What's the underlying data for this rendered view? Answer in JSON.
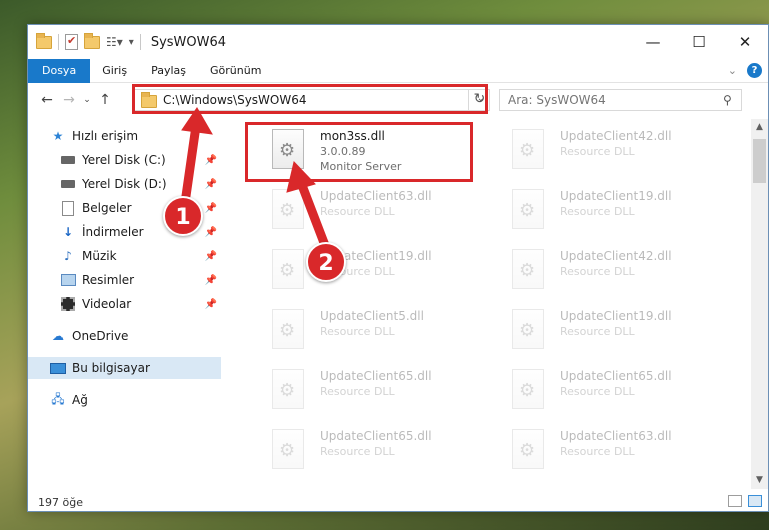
{
  "window": {
    "title": "SysWOW64",
    "controls": {
      "minimize": "—",
      "maximize": "☐",
      "close": "✕"
    }
  },
  "ribbon": {
    "tabs": [
      "Dosya",
      "Giriş",
      "Paylaş",
      "Görünüm"
    ],
    "active_tab": "Dosya"
  },
  "nav": {
    "address": "C:\\Windows\\SysWOW64",
    "search_placeholder": "Ara: SysWOW64"
  },
  "sidebar": {
    "items": [
      {
        "label": "Hızlı erişim",
        "icon": "star-icon",
        "pinned": false
      },
      {
        "label": "Yerel Disk (C:)",
        "icon": "drive-icon",
        "pinned": true
      },
      {
        "label": "Yerel Disk (D:)",
        "icon": "drive-icon",
        "pinned": true
      },
      {
        "label": "Belgeler",
        "icon": "documents-icon",
        "pinned": true
      },
      {
        "label": "İndirmeler",
        "icon": "downloads-icon",
        "pinned": true
      },
      {
        "label": "Müzik",
        "icon": "music-icon",
        "pinned": true
      },
      {
        "label": "Resimler",
        "icon": "pictures-icon",
        "pinned": true
      },
      {
        "label": "Videolar",
        "icon": "videos-icon",
        "pinned": true
      },
      {
        "label": "OneDrive",
        "icon": "onedrive-icon",
        "pinned": false
      },
      {
        "label": "Bu bilgisayar",
        "icon": "this-pc-icon",
        "pinned": false,
        "selected": true
      },
      {
        "label": "Ağ",
        "icon": "network-icon",
        "pinned": false
      }
    ]
  },
  "files": [
    {
      "name": "mon3ss.dll",
      "version": "3.0.0.89",
      "description": "Monitor Server",
      "highlighted": true
    },
    {
      "name": "UpdateClient42.dll",
      "description": "Resource DLL"
    },
    {
      "name": "UpdateClient63.dll",
      "description": "Resource DLL"
    },
    {
      "name": "UpdateClient19.dll",
      "description": "Resource DLL"
    },
    {
      "name": "UpdateClient19.dll",
      "description": "Resource DLL"
    },
    {
      "name": "UpdateClient42.dll",
      "description": "Resource DLL"
    },
    {
      "name": "UpdateClient5.dll",
      "description": "Resource DLL"
    },
    {
      "name": "UpdateClient19.dll",
      "description": "Resource DLL"
    },
    {
      "name": "UpdateClient65.dll",
      "description": "Resource DLL"
    },
    {
      "name": "UpdateClient65.dll",
      "description": "Resource DLL"
    },
    {
      "name": "UpdateClient65.dll",
      "description": "Resource DLL"
    },
    {
      "name": "UpdateClient63.dll",
      "description": "Resource DLL"
    }
  ],
  "status": {
    "item_count": "197 öğe"
  },
  "annotations": {
    "step1": "1",
    "step2": "2",
    "color": "#d9282a"
  }
}
